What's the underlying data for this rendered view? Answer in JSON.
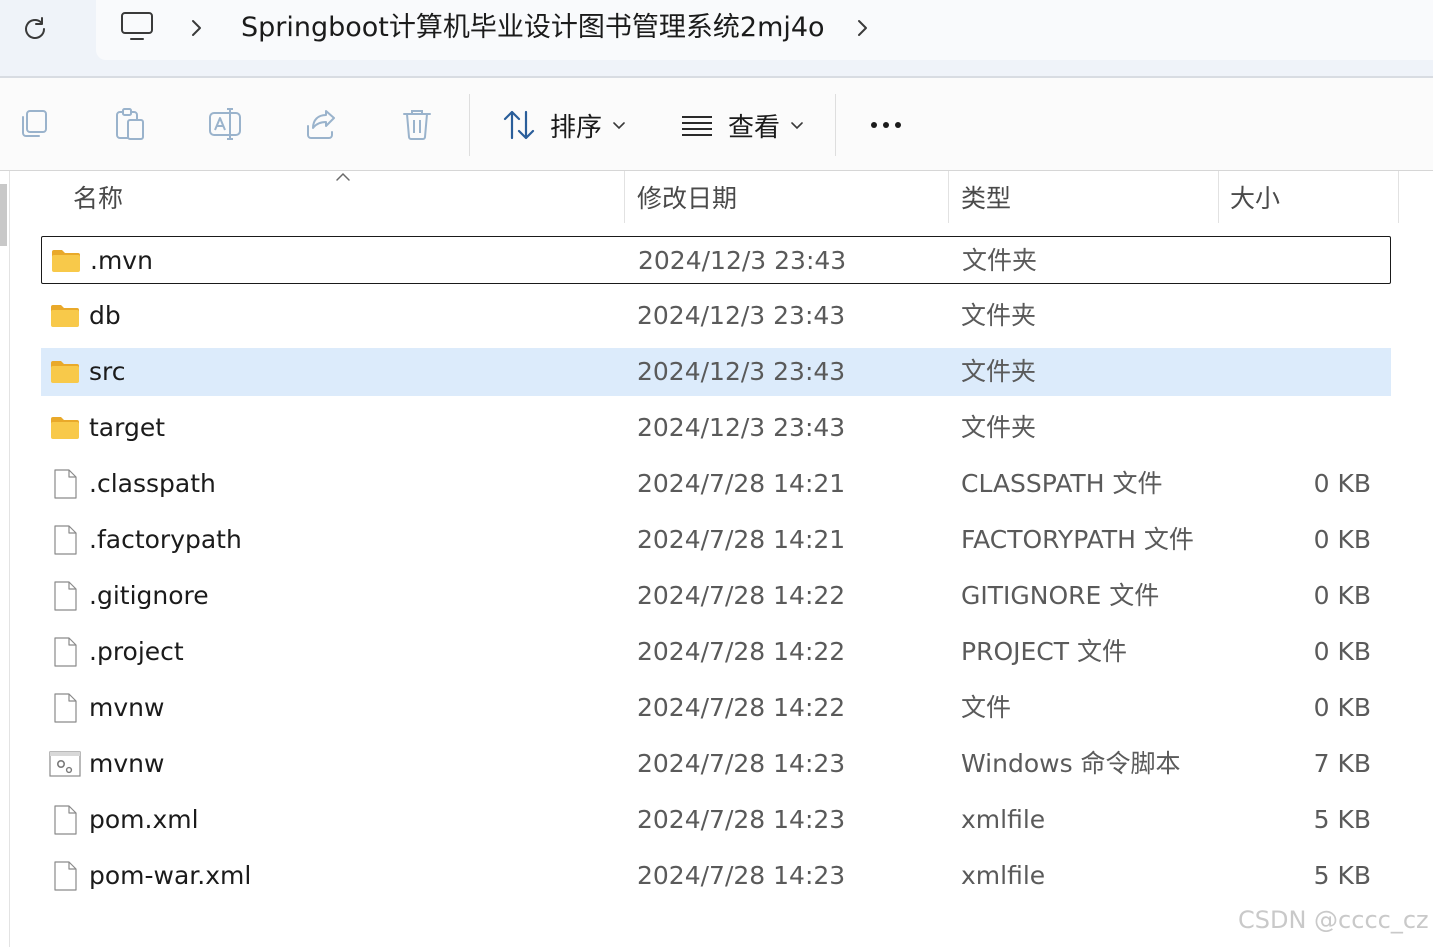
{
  "address": {
    "crumbs": [
      "Springboot计算机毕业设计图书管理系统2mj4o"
    ]
  },
  "toolbar": {
    "icons": [
      "copy-icon",
      "paste-icon",
      "rename-icon",
      "share-icon",
      "delete-icon"
    ],
    "sort_label": "排序",
    "view_label": "查看"
  },
  "columns": {
    "name": "名称",
    "date": "修改日期",
    "type": "类型",
    "size": "大小"
  },
  "files": [
    {
      "name": ".mvn",
      "date": "2024/12/3 23:43",
      "type": "文件夹",
      "size": "",
      "icon": "folder-icon",
      "state": "focused"
    },
    {
      "name": "db",
      "date": "2024/12/3 23:43",
      "type": "文件夹",
      "size": "",
      "icon": "folder-icon",
      "state": ""
    },
    {
      "name": "src",
      "date": "2024/12/3 23:43",
      "type": "文件夹",
      "size": "",
      "icon": "folder-icon",
      "state": "selected"
    },
    {
      "name": "target",
      "date": "2024/12/3 23:43",
      "type": "文件夹",
      "size": "",
      "icon": "folder-icon",
      "state": ""
    },
    {
      "name": ".classpath",
      "date": "2024/7/28 14:21",
      "type": "CLASSPATH 文件",
      "size": "0 KB",
      "icon": "file-icon",
      "state": ""
    },
    {
      "name": ".factorypath",
      "date": "2024/7/28 14:21",
      "type": "FACTORYPATH 文件",
      "size": "0 KB",
      "icon": "file-icon",
      "state": ""
    },
    {
      "name": ".gitignore",
      "date": "2024/7/28 14:22",
      "type": "GITIGNORE 文件",
      "size": "0 KB",
      "icon": "file-icon",
      "state": ""
    },
    {
      "name": ".project",
      "date": "2024/7/28 14:22",
      "type": "PROJECT 文件",
      "size": "0 KB",
      "icon": "file-icon",
      "state": ""
    },
    {
      "name": "mvnw",
      "date": "2024/7/28 14:22",
      "type": "文件",
      "size": "0 KB",
      "icon": "file-icon",
      "state": ""
    },
    {
      "name": "mvnw",
      "date": "2024/7/28 14:23",
      "type": "Windows 命令脚本",
      "size": "7 KB",
      "icon": "script-file-icon",
      "state": ""
    },
    {
      "name": "pom.xml",
      "date": "2024/7/28 14:23",
      "type": "xmlfile",
      "size": "5 KB",
      "icon": "file-icon",
      "state": ""
    },
    {
      "name": "pom-war.xml",
      "date": "2024/7/28 14:23",
      "type": "xmlfile",
      "size": "5 KB",
      "icon": "file-icon",
      "state": ""
    }
  ],
  "watermark": "CSDN @cccc_cz",
  "colors": {
    "selected_row": "#dcebfb",
    "folder": "#f8c94a",
    "address_bar": "#eff3f9"
  }
}
